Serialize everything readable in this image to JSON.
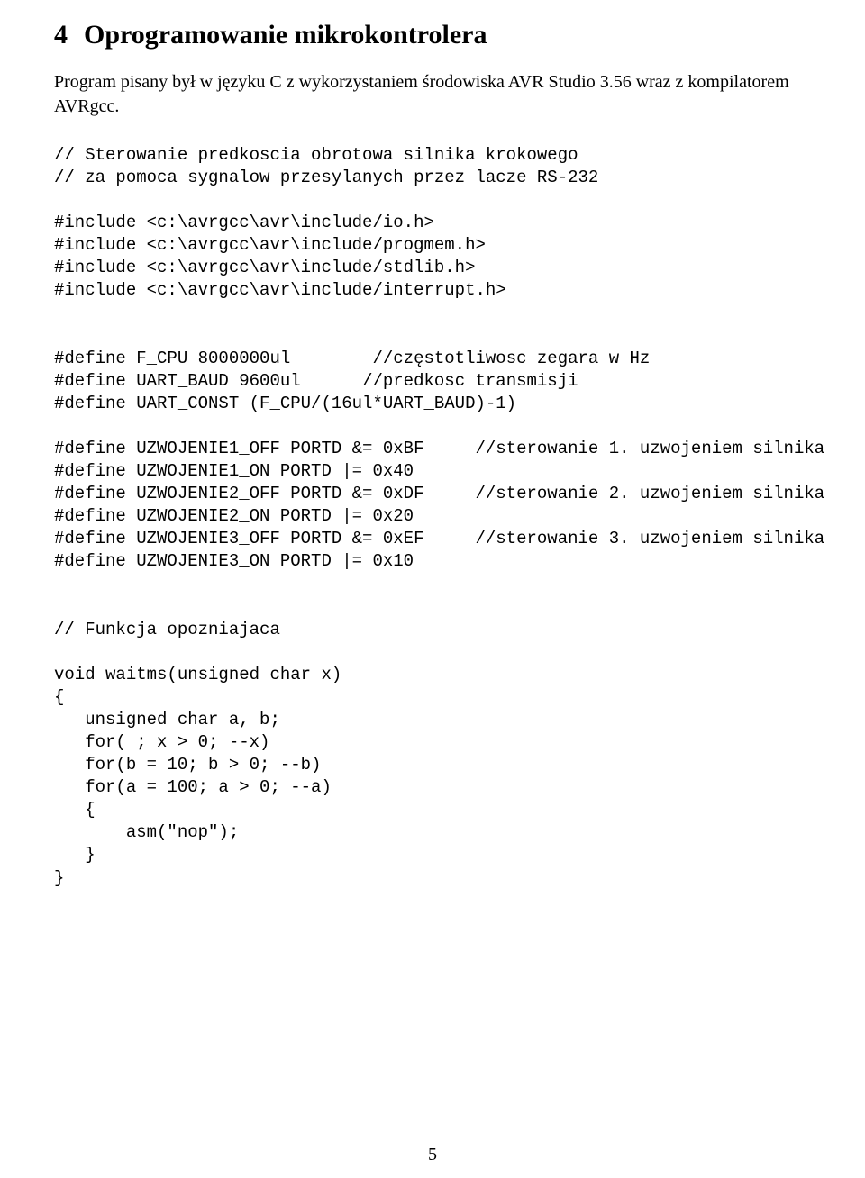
{
  "section": {
    "number": "4",
    "title": "Oprogramowanie mikrokontrolera"
  },
  "intro": "Program pisany był w języku C z wykorzystaniem środowiska AVR Studio 3.56 wraz z kompilatorem AVRgcc.",
  "code": {
    "c1": "// Sterowanie predkoscia obrotowa silnika krokowego",
    "c2": "// za pomoca sygnalow przesylanych przez lacze RS-232",
    "inc1": "#include <c:\\avrgcc\\avr\\include/io.h>",
    "inc2": "#include <c:\\avrgcc\\avr\\include/progmem.h>",
    "inc3": "#include <c:\\avrgcc\\avr\\include/stdlib.h>",
    "inc4": "#include <c:\\avrgcc\\avr\\include/interrupt.h>",
    "d1a": "#define F_CPU 8000000ul",
    "d1b": "//częstotliwosc zegara w Hz",
    "d2a": "#define UART_BAUD 9600ul",
    "d2b": "//predkosc transmisji",
    "d3": "#define UART_CONST (F_CPU/(16ul*UART_BAUD)-1)",
    "u1a": "#define UZWOJENIE1_OFF PORTD &= 0xBF",
    "u1b": "//sterowanie 1. uzwojeniem silnika",
    "u1c": "#define UZWOJENIE1_ON PORTD |= 0x40",
    "u2a": "#define UZWOJENIE2_OFF PORTD &= 0xDF",
    "u2b": "//sterowanie 2. uzwojeniem silnika",
    "u2c": "#define UZWOJENIE2_ON PORTD |= 0x20",
    "u3a": "#define UZWOJENIE3_OFF PORTD &= 0xEF",
    "u3b": "//sterowanie 3. uzwojeniem silnika",
    "u3c": "#define UZWOJENIE3_ON PORTD |= 0x10",
    "fnc": "// Funkcja opozniajaca",
    "f1": "void waitms(unsigned char x)",
    "f2": "{",
    "f3": "   unsigned char a, b;",
    "f4": "   for( ; x > 0; --x)",
    "f5": "   for(b = 10; b > 0; --b)",
    "f6": "   for(a = 100; a > 0; --a)",
    "f7": "   {",
    "f8": "     __asm(\"nop\");",
    "f9": "   }",
    "f10": "}"
  },
  "page_number": "5"
}
